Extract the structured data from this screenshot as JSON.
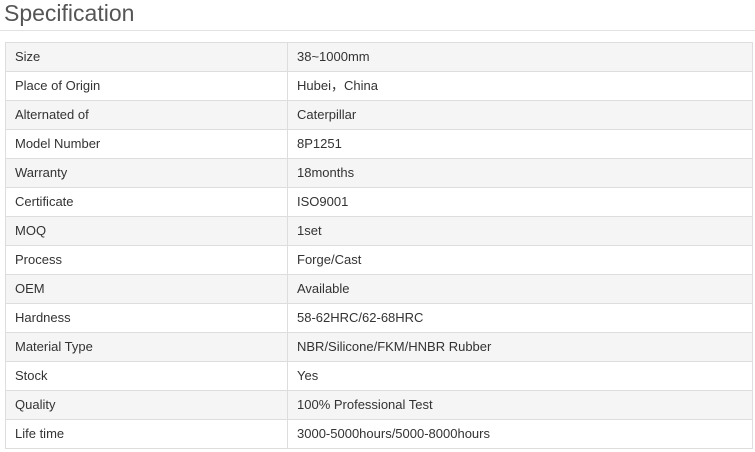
{
  "heading": "Specification",
  "rows": [
    {
      "label": "Size",
      "value": "38~1000mm"
    },
    {
      "label": "Place of Origin",
      "value": "Hubei，China"
    },
    {
      "label": "Alternated of",
      "value": "Caterpillar"
    },
    {
      "label": "Model Number",
      "value": "8P1251"
    },
    {
      "label": "Warranty",
      "value": "18months"
    },
    {
      "label": "Certificate",
      "value": "ISO9001"
    },
    {
      "label": "MOQ",
      "value": "1set"
    },
    {
      "label": "Process",
      "value": "Forge/Cast"
    },
    {
      "label": "OEM",
      "value": "Available"
    },
    {
      "label": "Hardness",
      "value": "58-62HRC/62-68HRC"
    },
    {
      "label": "Material Type",
      "value": "NBR/Silicone/FKM/HNBR Rubber"
    },
    {
      "label": "Stock",
      "value": "Yes"
    },
    {
      "label": "Quality",
      "value": "100% Professional Test"
    },
    {
      "label": "Life time",
      "value": "3000-5000hours/5000-8000hours"
    }
  ]
}
